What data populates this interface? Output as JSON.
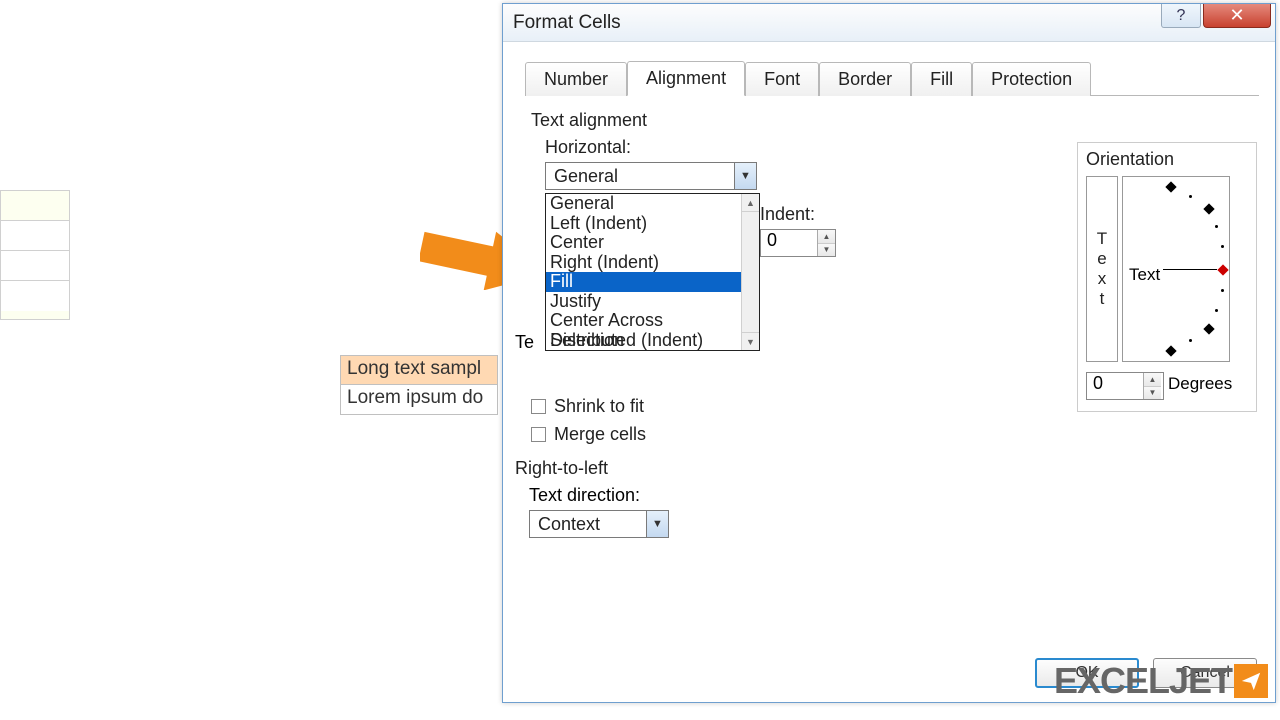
{
  "dialog": {
    "title": "Format Cells",
    "tabs": [
      "Number",
      "Alignment",
      "Font",
      "Border",
      "Fill",
      "Protection"
    ],
    "active_tab": "Alignment",
    "text_alignment_label": "Text alignment",
    "horizontal_label": "Horizontal:",
    "horizontal_value": "General",
    "horizontal_options": [
      "General",
      "Left (Indent)",
      "Center",
      "Right (Indent)",
      "Fill",
      "Justify",
      "Center Across Selection",
      "Distributed (Indent)"
    ],
    "horizontal_selected": "Fill",
    "indent_label": "Indent:",
    "indent_value": "0",
    "text_control_partial": "Te",
    "shrink_label": "Shrink to fit",
    "merge_label": "Merge cells",
    "r2l_label": "Right-to-left",
    "text_direction_label": "Text direction:",
    "text_direction_value": "Context",
    "orientation_label": "Orientation",
    "orientation_vertical": [
      "T",
      "e",
      "x",
      "t"
    ],
    "orientation_text": "Text",
    "degrees_value": "0",
    "degrees_label": "Degrees",
    "ok_label": "OK",
    "cancel_label": "Cancel"
  },
  "sheet": {
    "cell1": "Long text sampl",
    "cell2": "Lorem ipsum do"
  },
  "watermark": "EXCELJET",
  "colors": {
    "highlight_bg": "#0a64c8",
    "arrow": "#f28c1a",
    "close_btn": "#c8412f"
  }
}
